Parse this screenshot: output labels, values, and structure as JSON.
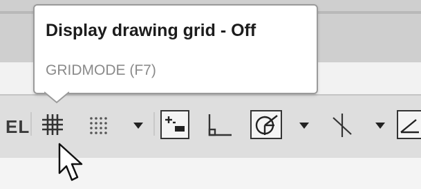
{
  "tooltip": {
    "title": "Display drawing grid - Off",
    "command": "GRIDMODE (F7)"
  },
  "statusbar": {
    "partial_label": "EL",
    "items": [
      {
        "name": "grid",
        "icon": "grid-icon",
        "state": "off"
      },
      {
        "name": "snap",
        "icon": "snap-dots-icon"
      },
      {
        "name": "snap-dropdown",
        "icon": "chevron-down-icon"
      },
      {
        "name": "dynamic-input",
        "icon": "dynamic-input-icon",
        "boxed": true
      },
      {
        "name": "ortho",
        "icon": "ortho-icon"
      },
      {
        "name": "polar",
        "icon": "polar-tracking-icon",
        "boxed": true
      },
      {
        "name": "polar-dropdown",
        "icon": "chevron-down-icon"
      },
      {
        "name": "isodraft",
        "icon": "isodraft-icon"
      },
      {
        "name": "isodraft-dropdown",
        "icon": "chevron-down-icon"
      },
      {
        "name": "object-snap",
        "icon": "object-snap-icon",
        "boxed": true
      }
    ]
  },
  "colors": {
    "top_band": "#cfcfcf",
    "statusbar": "#dedede",
    "icon": "#333333",
    "tooltip_title": "#1c1c1c",
    "tooltip_command": "#8a8a8a"
  }
}
